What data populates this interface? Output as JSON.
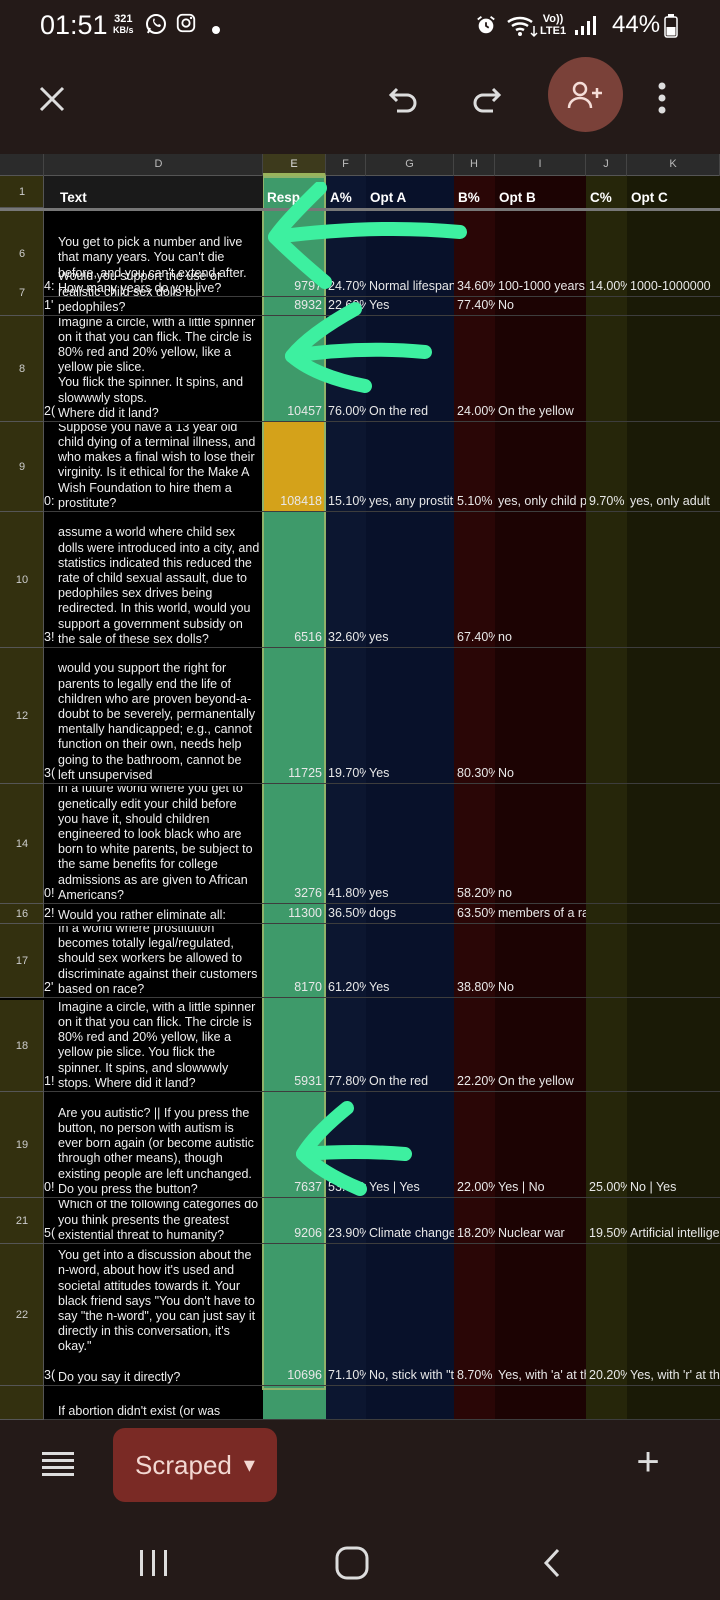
{
  "status": {
    "time": "01:51",
    "kbs_value": "321",
    "kbs_unit": "KB/s",
    "volte": "Vo))",
    "lte": "LTE1",
    "battery": "44%",
    "icons": [
      "whatsapp-icon",
      "instagram-icon",
      "dot-icon",
      "alarm-icon",
      "wifi-icon",
      "signal-icon",
      "battery-icon"
    ]
  },
  "toolbar": {
    "icons": [
      "close-icon",
      "undo-icon",
      "redo-icon",
      "add-person-icon",
      "more-vert-icon"
    ]
  },
  "colors": {
    "accent": "#7a4139",
    "chip": "#7a2a25",
    "response_col": "#3e9a6a",
    "highlight_cell": "#d4a21a",
    "arrow": "#3df0a0"
  },
  "sheet": {
    "columns": [
      "D",
      "E",
      "F",
      "G",
      "H",
      "I",
      "J",
      "K"
    ],
    "headers": {
      "row": "1",
      "text": "Text",
      "resp": "Resp",
      "a_pct": "A%",
      "opt_a": "Opt A",
      "b_pct": "B%",
      "opt_b": "Opt B",
      "c_pct": "C%",
      "opt_c": "Opt C"
    },
    "rows": [
      {
        "num": "6",
        "prefix": "4:",
        "text": "You get to pick a number and live that many years. You can't die before, and you can't extend after.\nHow many years do you live?",
        "resp": "9797",
        "a": "24.70%",
        "opt_a": "Normal lifespan",
        "b": "34.60%",
        "opt_b": "100-1000 years",
        "c": "14.00%",
        "opt_c": "1000-1000000"
      },
      {
        "num": "7",
        "prefix": "1'",
        "text": "Would you support the use of realistic child sex dolls for pedophiles?",
        "resp": "8932",
        "a": "22.60%",
        "opt_a": "Yes",
        "b": "77.40%",
        "opt_b": "No",
        "c": "",
        "opt_c": ""
      },
      {
        "num": "8",
        "prefix": "2(",
        "text": "Imagine a circle, with a little spinner on it that you can flick. The circle is 80% red and 20% yellow, like a yellow pie slice.\nYou flick the spinner. It spins, and slowwwly stops.\nWhere did it land?",
        "resp": "10457",
        "a": "76.00%",
        "opt_a": "On the red",
        "b": "24.00%",
        "opt_b": "On the yellow",
        "c": "",
        "opt_c": ""
      },
      {
        "num": "9",
        "prefix": "0:",
        "text": "Suppose you have a 13 year old child dying of a terminal illness, and who makes a final wish to lose their virginity. Is it ethical for the Make A Wish Foundation to hire them a prostitute?",
        "resp": "108418",
        "a": "15.10%",
        "opt_a": "yes, any prostitute",
        "b": "5.10%",
        "opt_b": "yes, only child prostitutes",
        "c": "9.70%",
        "opt_c": "yes, only adult"
      },
      {
        "num": "10",
        "prefix": "3!",
        "text": "assume a world where child sex dolls were introduced into a city, and statistics indicated this reduced the rate of child sexual assault, due to pedophiles sex drives being redirected. In this world, would you support a government subsidy on the sale of these sex dolls?",
        "resp": "6516",
        "a": "32.60%",
        "opt_a": "yes",
        "b": "67.40%",
        "opt_b": "no",
        "c": "",
        "opt_c": ""
      },
      {
        "num": "12",
        "prefix": "3(",
        "text": "would you support the right for parents to legally end the life of children who are proven beyond-a-doubt to be severely, permanentally mentally handicapped; e.g., cannot function on their own, needs help going to the bathroom, cannot be left unsupervised",
        "resp": "11725",
        "a": "19.70%",
        "opt_a": "Yes",
        "b": "80.30%",
        "opt_b": "No",
        "c": "",
        "opt_c": ""
      },
      {
        "num": "14",
        "prefix": "0!",
        "text": "in a future world where you get to genetically edit your child before you have it, should children engineered to look black who are born to white parents, be subject to the same benefits for college admissions as are given to African Americans?",
        "resp": "3276",
        "a": "41.80%",
        "opt_a": "yes",
        "b": "58.20%",
        "opt_b": "no",
        "c": "",
        "opt_c": ""
      },
      {
        "num": "16",
        "prefix": "2!",
        "text": "Would you rather eliminate all:",
        "resp": "11300",
        "a": "36.50%",
        "opt_a": "dogs",
        "b": "63.50%",
        "opt_b": "members of a race",
        "c": "",
        "opt_c": ""
      },
      {
        "num": "17",
        "prefix": "2'",
        "text": "In a world where prostitution becomes totally legal/regulated, should sex workers be allowed to discriminate against their customers based on race?",
        "resp": "8170",
        "a": "61.20%",
        "opt_a": "Yes",
        "b": "38.80%",
        "opt_b": "No",
        "c": "",
        "opt_c": ""
      },
      {
        "num": "18",
        "prefix": "1!",
        "text": "Imagine a circle, with a little spinner on it that you can flick. The circle is 80% red and 20% yellow, like a yellow pie slice. You flick the spinner. It spins, and slowwwly stops. Where did it land?",
        "resp": "5931",
        "a": "77.80%",
        "opt_a": "On the red",
        "b": "22.20%",
        "opt_b": "On the yellow",
        "c": "",
        "opt_c": ""
      },
      {
        "num": "19",
        "prefix": "0!",
        "text": "Are you autistic? || If you press the button, no person with autism is ever born again (or become autistic through other means), though existing people are left unchanged. Do you press the button?",
        "resp": "7637",
        "a": "53.90%",
        "opt_a": "Yes | Yes",
        "b": "22.00%",
        "opt_b": "Yes | No",
        "c": "25.00%",
        "opt_c": "No | Yes"
      },
      {
        "num": "21",
        "prefix": "5(",
        "text": "Which of the following categories do you think presents the greatest existential threat to humanity?",
        "resp": "9206",
        "a": "23.90%",
        "opt_a": "Climate change",
        "b": "18.20%",
        "opt_b": "Nuclear war",
        "c": "19.50%",
        "opt_c": "Artificial intelligence"
      },
      {
        "num": "22",
        "prefix": "3(",
        "text": "You get into a discussion about the n-word, about how it's used and societal attitudes towards it. Your black friend says \"You don't have to say \"the n-word\", you can just say it directly in this conversation, it's okay.\"\n\nDo you say it directly?",
        "resp": "10696",
        "a": "71.10%",
        "opt_a": "No, stick with \"the n-word\"",
        "b": "8.70%",
        "opt_b": "Yes, with 'a' at the end",
        "c": "20.20%",
        "opt_c": "Yes, with 'r' at the end"
      },
      {
        "num": "",
        "prefix": "",
        "text": "If abortion didn't exist (or was",
        "resp": "",
        "a": "",
        "opt_a": "",
        "b": "",
        "opt_b": "",
        "c": "",
        "opt_c": ""
      }
    ]
  },
  "bottom": {
    "sheet_tab": "Scraped",
    "tab_caret": "▾",
    "add": "+"
  },
  "nav": {
    "icons": [
      "recents-icon",
      "home-icon",
      "back-icon"
    ]
  }
}
